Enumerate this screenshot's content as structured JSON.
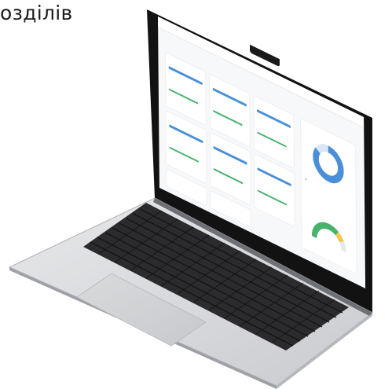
{
  "headline": "озділів",
  "screen": {
    "app_title": "",
    "page_title": "",
    "section_title": "",
    "cards": [
      {
        "title": "",
        "sub": "",
        "pct": ""
      },
      {
        "title": "",
        "sub": "",
        "pct": ""
      },
      {
        "title": "",
        "sub": "",
        "pct": ""
      },
      {
        "title": "",
        "sub": "",
        "pct": ""
      },
      {
        "title": "",
        "sub": "",
        "pct": ""
      },
      {
        "title": "",
        "sub": "",
        "pct": ""
      },
      {
        "title": "",
        "sub": "",
        "pct": ""
      },
      {
        "title": "",
        "sub": "",
        "pct": ""
      }
    ],
    "panel_top_title": "",
    "panel_bottom_title": ""
  },
  "colors": {
    "accent_blue": "#4a8fd8",
    "accent_green": "#45b36b",
    "gauge_yellow": "#f2c94c"
  }
}
